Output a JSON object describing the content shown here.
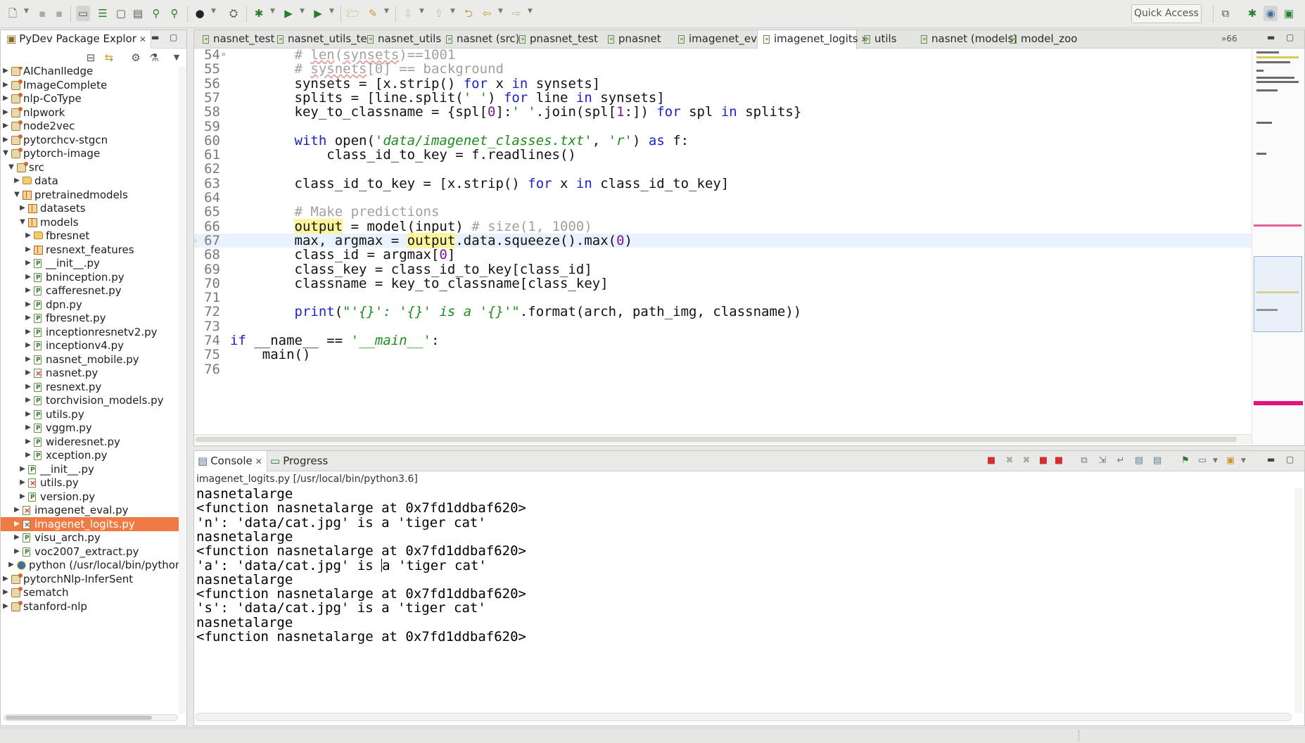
{
  "toolbar": {
    "quick_access": "Quick Access"
  },
  "explorer": {
    "title": "PyDev Package Explor",
    "tree": [
      {
        "label": "AIChanlledge",
        "depth": 0,
        "icon": "project",
        "open": false
      },
      {
        "label": "ImageComplete",
        "depth": 0,
        "icon": "project",
        "open": false
      },
      {
        "label": "nlp-CoType",
        "depth": 0,
        "icon": "project",
        "open": false
      },
      {
        "label": "nlpwork",
        "depth": 0,
        "icon": "project",
        "open": false
      },
      {
        "label": "node2vec",
        "depth": 0,
        "icon": "project",
        "open": false
      },
      {
        "label": "pytorchcv-stgcn",
        "depth": 0,
        "icon": "project",
        "open": false
      },
      {
        "label": "pytorch-image",
        "depth": 0,
        "icon": "project",
        "open": true
      },
      {
        "label": "src",
        "depth": 1,
        "icon": "project",
        "open": true
      },
      {
        "label": "data",
        "depth": 2,
        "icon": "folder",
        "open": false
      },
      {
        "label": "pretrainedmodels",
        "depth": 2,
        "icon": "package",
        "open": true
      },
      {
        "label": "datasets",
        "depth": 3,
        "icon": "package",
        "open": false
      },
      {
        "label": "models",
        "depth": 3,
        "icon": "package",
        "open": true
      },
      {
        "label": "fbresnet",
        "depth": 4,
        "icon": "folder",
        "open": false
      },
      {
        "label": "resnext_features",
        "depth": 4,
        "icon": "package",
        "open": false
      },
      {
        "label": "__init__.py",
        "depth": 4,
        "icon": "py",
        "open": false
      },
      {
        "label": "bninception.py",
        "depth": 4,
        "icon": "py",
        "open": false
      },
      {
        "label": "cafferesnet.py",
        "depth": 4,
        "icon": "py",
        "open": false
      },
      {
        "label": "dpn.py",
        "depth": 4,
        "icon": "py",
        "open": false
      },
      {
        "label": "fbresnet.py",
        "depth": 4,
        "icon": "py",
        "open": false
      },
      {
        "label": "inceptionresnetv2.py",
        "depth": 4,
        "icon": "py",
        "open": false
      },
      {
        "label": "inceptionv4.py",
        "depth": 4,
        "icon": "py",
        "open": false
      },
      {
        "label": "nasnet_mobile.py",
        "depth": 4,
        "icon": "py",
        "open": false
      },
      {
        "label": "nasnet.py",
        "depth": 4,
        "icon": "pyerr",
        "open": false
      },
      {
        "label": "resnext.py",
        "depth": 4,
        "icon": "py",
        "open": false
      },
      {
        "label": "torchvision_models.py",
        "depth": 4,
        "icon": "py",
        "open": false
      },
      {
        "label": "utils.py",
        "depth": 4,
        "icon": "py",
        "open": false
      },
      {
        "label": "vggm.py",
        "depth": 4,
        "icon": "py",
        "open": false
      },
      {
        "label": "wideresnet.py",
        "depth": 4,
        "icon": "py",
        "open": false
      },
      {
        "label": "xception.py",
        "depth": 4,
        "icon": "py",
        "open": false
      },
      {
        "label": "__init__.py",
        "depth": 3,
        "icon": "py",
        "open": false
      },
      {
        "label": "utils.py",
        "depth": 3,
        "icon": "pyerr",
        "open": false
      },
      {
        "label": "version.py",
        "depth": 3,
        "icon": "py",
        "open": false
      },
      {
        "label": "imagenet_eval.py",
        "depth": 2,
        "icon": "pyerr",
        "open": false
      },
      {
        "label": "imagenet_logits.py",
        "depth": 2,
        "icon": "pyerr",
        "open": false,
        "selected": true
      },
      {
        "label": "visu_arch.py",
        "depth": 2,
        "icon": "py",
        "open": false
      },
      {
        "label": "voc2007_extract.py",
        "depth": 2,
        "icon": "py",
        "open": false
      },
      {
        "label": "python (/usr/local/bin/python3",
        "depth": 1,
        "icon": "python",
        "open": false
      },
      {
        "label": "pytorchNlp-InferSent",
        "depth": 0,
        "icon": "project",
        "open": false
      },
      {
        "label": "sematch",
        "depth": 0,
        "icon": "project",
        "open": false
      },
      {
        "label": "stanford-nlp",
        "depth": 0,
        "icon": "project",
        "open": false
      }
    ]
  },
  "editor": {
    "tabs": [
      {
        "label": "nasnet_test"
      },
      {
        "label": "nasnet_utils_te"
      },
      {
        "label": "nasnet_utils"
      },
      {
        "label": "nasnet (src)"
      },
      {
        "label": "pnasnet_test"
      },
      {
        "label": "pnasnet"
      },
      {
        "label": "imagenet_eval"
      },
      {
        "label": "imagenet_logits",
        "active": true
      },
      {
        "label": "utils"
      },
      {
        "label": "nasnet (models)"
      },
      {
        "label": "model_zoo"
      }
    ],
    "more_tabs": "»66",
    "current_line": 67,
    "lines": [
      {
        "n": "54",
        "mark": "fold",
        "html": "        <span class=\"cm\"># <span class=\"sq\">len</span>(<span class=\"sq\">synsets</span>)==1001</span>"
      },
      {
        "n": "55",
        "html": "        <span class=\"cm\"># <span class=\"sq\">sysnets</span>[0] == background</span>"
      },
      {
        "n": "56",
        "html": "        synsets = [x.strip() <span class=\"kw\">for</span> x <span class=\"kw\">in</span> synsets]"
      },
      {
        "n": "57",
        "html": "        splits = [line.split(<span class=\"str\">' '</span>) <span class=\"kw\">for</span> line <span class=\"kw\">in</span> synsets]"
      },
      {
        "n": "58",
        "html": "        key_to_classname = {spl[<span class=\"num\">0</span>]:<span class=\"str\">' '</span>.join(spl[<span class=\"num\">1</span>:]) <span class=\"kw\">for</span> spl <span class=\"kw\">in</span> splits}"
      },
      {
        "n": "59",
        "html": ""
      },
      {
        "n": "60",
        "html": "        <span class=\"kw\">with</span> open(<span class=\"str\">'data/imagenet_classes.txt'</span>, <span class=\"str\">'r'</span>) <span class=\"kw\">as</span> f:"
      },
      {
        "n": "61",
        "html": "            class_id_to_key = f.readlines()"
      },
      {
        "n": "62",
        "html": ""
      },
      {
        "n": "63",
        "html": "        class_id_to_key = [x.strip() <span class=\"kw\">for</span> x <span class=\"kw\">in</span> class_id_to_key]"
      },
      {
        "n": "64",
        "html": ""
      },
      {
        "n": "65",
        "html": "        <span class=\"cm\"># Make predictions</span>"
      },
      {
        "n": "66",
        "html": "        <span class=\"hl\">output</span> = model(input) <span class=\"cm\"># size(1, 1000)</span>"
      },
      {
        "n": "67",
        "mark": "warn",
        "html": "        max, argmax = <span class=\"hl\">output</span>.data.squeeze().max(<span class=\"num\">0</span>)"
      },
      {
        "n": "68",
        "html": "        class_id = argmax[<span class=\"num\">0</span>]"
      },
      {
        "n": "69",
        "html": "        class_key = class_id_to_key[class_id]"
      },
      {
        "n": "70",
        "html": "        classname = key_to_classname[class_key]"
      },
      {
        "n": "71",
        "html": ""
      },
      {
        "n": "72",
        "html": "        <span class=\"kw\">print</span>(<span class=\"str\">\"'{}': '{}' is a '{}'\"</span>.format(arch, path_img, classname))"
      },
      {
        "n": "73",
        "html": ""
      },
      {
        "n": "74",
        "html": "<span class=\"kw\">if</span> __name__ == <span class=\"str\">'__main__'</span>:"
      },
      {
        "n": "75",
        "html": "    main()"
      },
      {
        "n": "76",
        "html": ""
      }
    ]
  },
  "console": {
    "tabs": [
      {
        "label": "Console",
        "active": true
      },
      {
        "label": "Progress"
      }
    ],
    "path": "imagenet_logits.py [/usr/local/bin/python3.6]",
    "lines": [
      "nasnetalarge",
      "<function nasnetalarge at 0x7fd1ddbaf620>",
      "'n': 'data/cat.jpg' is a 'tiger cat'",
      "nasnetalarge",
      "<function nasnetalarge at 0x7fd1ddbaf620>",
      "'a': 'data/cat.jpg' is a 'tiger cat'",
      "nasnetalarge",
      "<function nasnetalarge at 0x7fd1ddbaf620>",
      "'s': 'data/cat.jpg' is a 'tiger cat'",
      "nasnetalarge",
      "<function nasnetalarge at 0x7fd1ddbaf620>"
    ],
    "caret_line": 5
  },
  "colors": {
    "selection": "#f07a46",
    "keyword": "#1c21cc",
    "string": "#1b8d1b",
    "comment": "#a0a0a0",
    "occurrence": "#fdf59c"
  }
}
